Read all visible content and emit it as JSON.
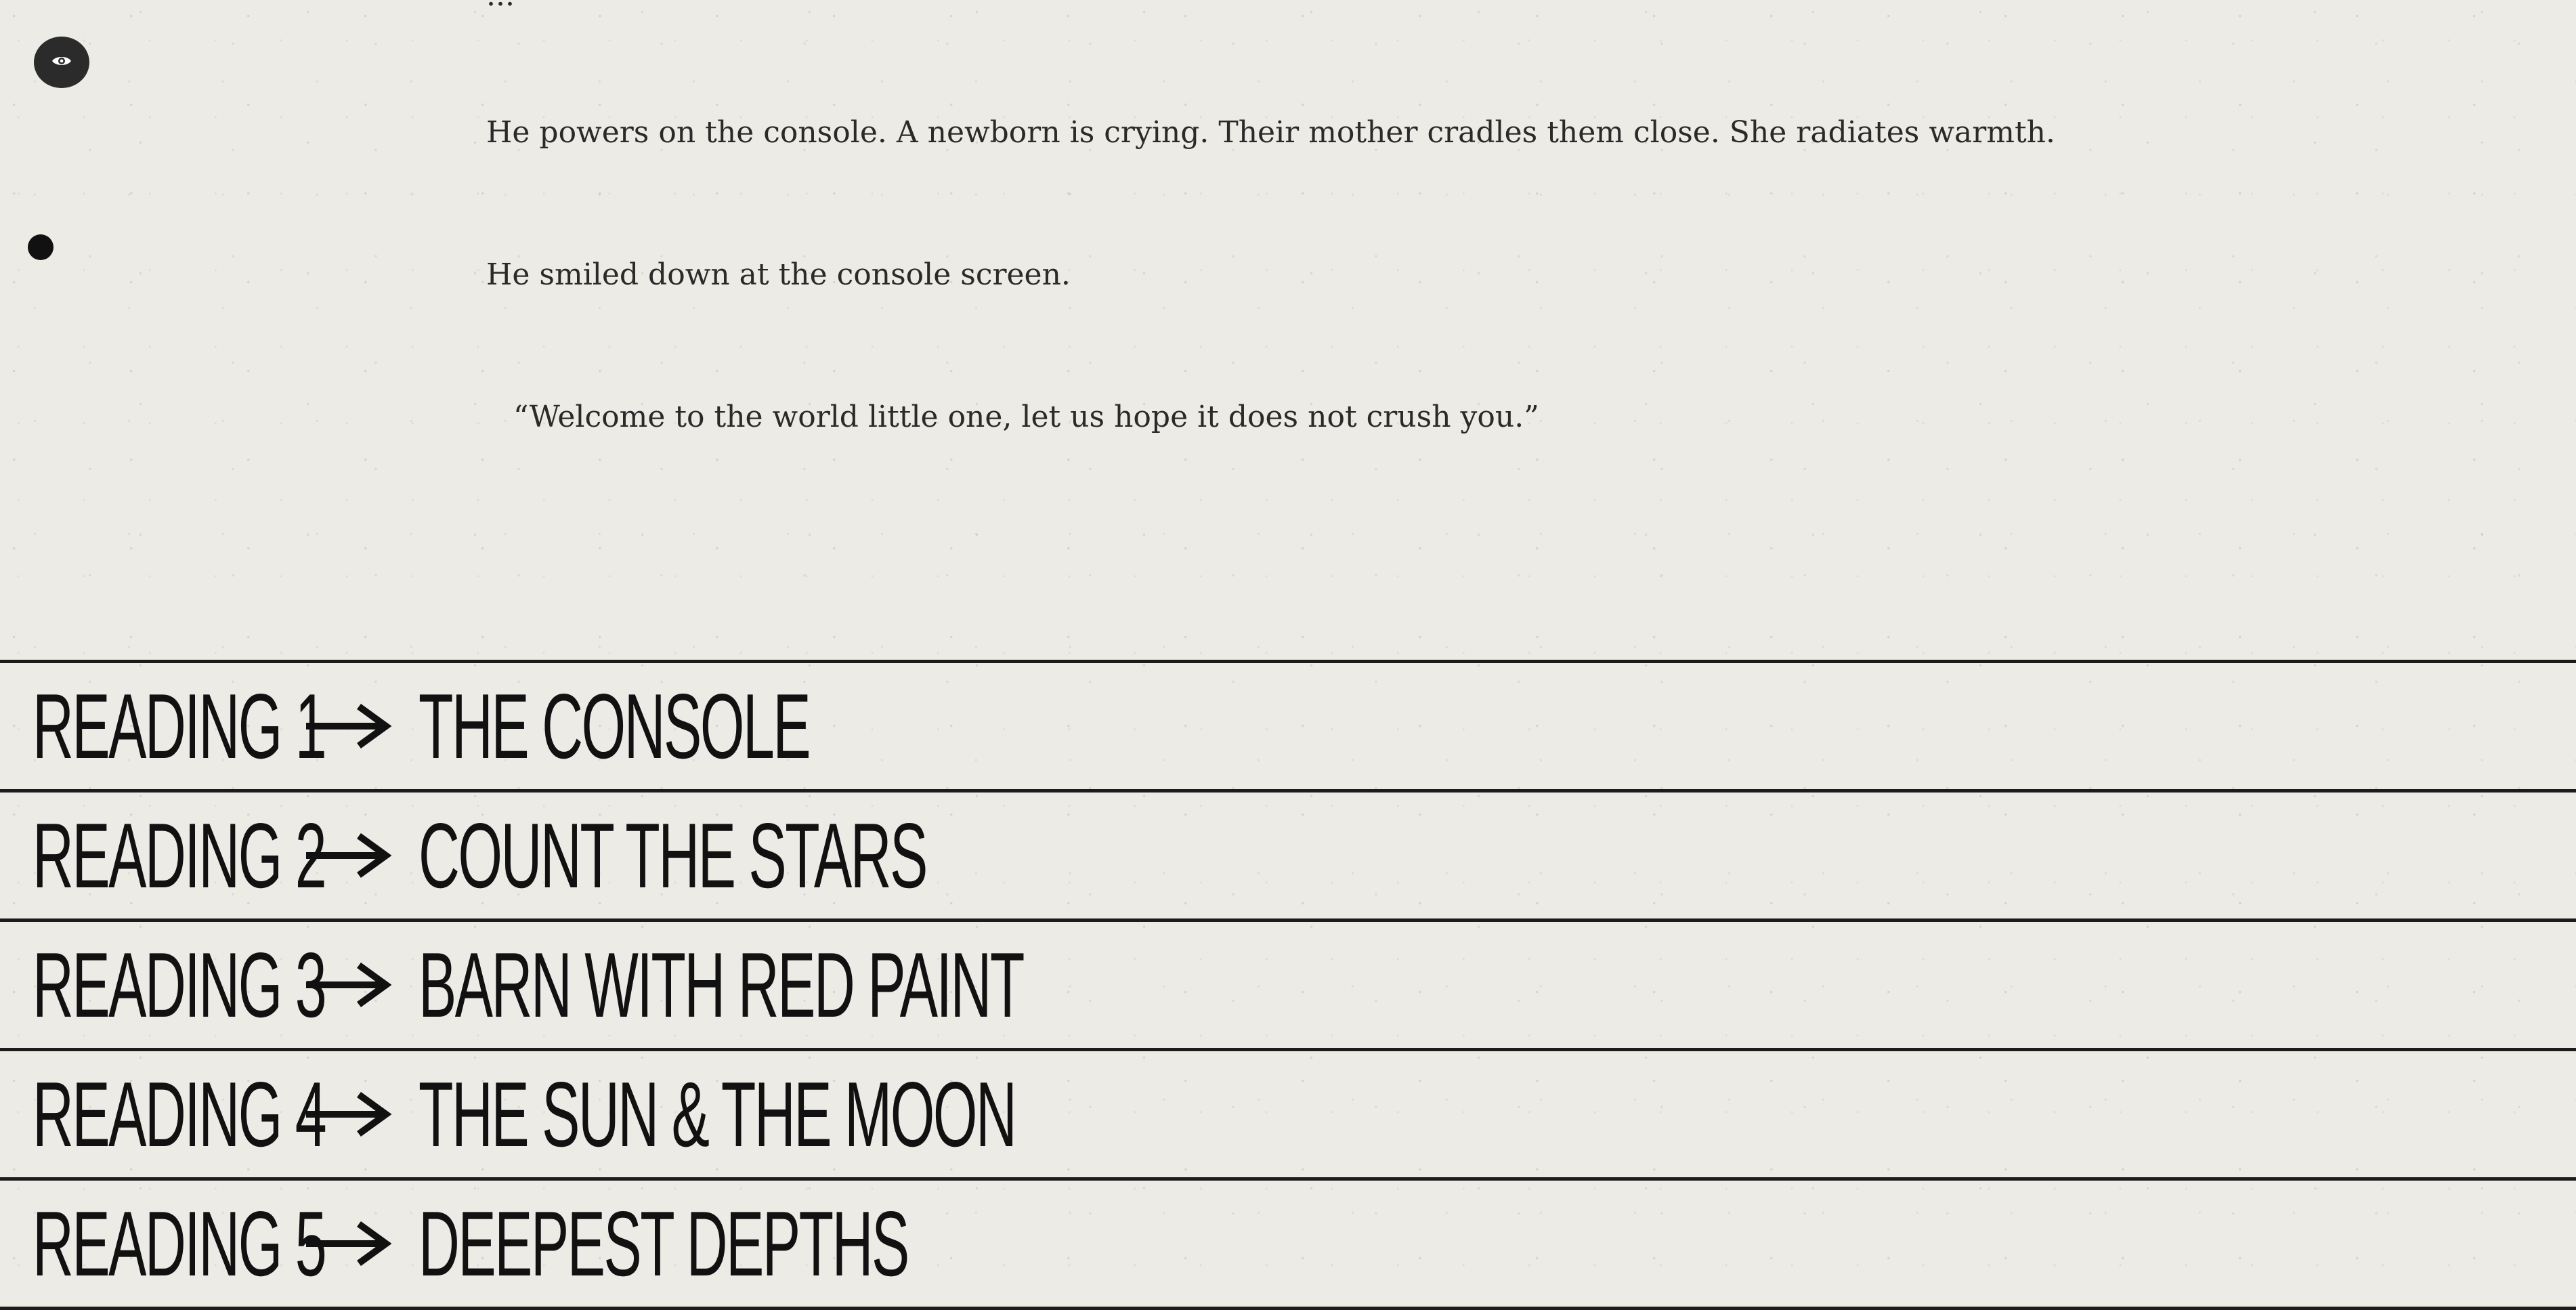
{
  "story": {
    "cut_line": "...",
    "line_1": "He powers on the console. A newborn is crying. Their mother cradles them close. She radiates warmth.",
    "line_2": "He smiled down at the console screen.",
    "line_3": "“Welcome to the world little one, let us hope it does not crush you.”"
  },
  "controls": {
    "eye_icon": "eye-icon",
    "indicator_icon": "dot-icon"
  },
  "readings": [
    {
      "label": "READING 1",
      "title": "THE CONSOLE"
    },
    {
      "label": "READING 2",
      "title": "COUNT THE STARS"
    },
    {
      "label": "READING 3",
      "title": "BARN WITH RED PAINT"
    },
    {
      "label": "READING 4",
      "title": "THE SUN & THE MOON"
    },
    {
      "label": "READING 5",
      "title": "DEEPEST DEPTHS"
    }
  ],
  "colors": {
    "background": "#edebe5",
    "text": "#1a1a1a",
    "rule": "#1c1c1c",
    "button": "#2b2b2b"
  }
}
